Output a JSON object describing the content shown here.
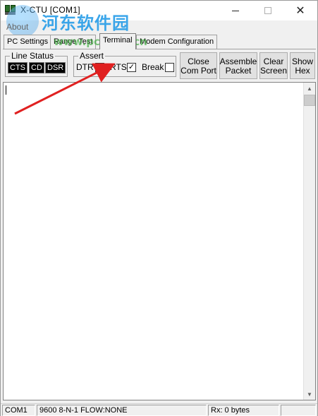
{
  "window": {
    "title": "X-CTU  [COM1]"
  },
  "menu": {
    "about": "About"
  },
  "watermark": {
    "text": "河东软件园",
    "url": "www.pc0359.cn"
  },
  "tabs": [
    {
      "label": "PC Settings"
    },
    {
      "label": "Range Test"
    },
    {
      "label": "Terminal"
    },
    {
      "label": "Modem Configuration"
    }
  ],
  "line_status": {
    "title": "Line Status",
    "indicators": [
      "CTS",
      "CD",
      "DSR"
    ]
  },
  "assert": {
    "title": "Assert",
    "dtr_label": "DTR",
    "rts_label": "RTS",
    "break_label": "Break",
    "dtr_checked": "✓",
    "rts_checked": "✓"
  },
  "buttons": {
    "close_com_port": [
      "Close",
      "Com Port"
    ],
    "assemble_packet": [
      "Assemble",
      "Packet"
    ],
    "clear_screen": [
      "Clear",
      "Screen"
    ],
    "show_hex": [
      "Show",
      "Hex"
    ]
  },
  "status": {
    "port": "COM1",
    "settings": "9600 8-N-1  FLOW:NONE",
    "rx": "Rx: 0 bytes"
  },
  "colors": {
    "arrow": "#e02020",
    "watermark": "#1996e6"
  }
}
